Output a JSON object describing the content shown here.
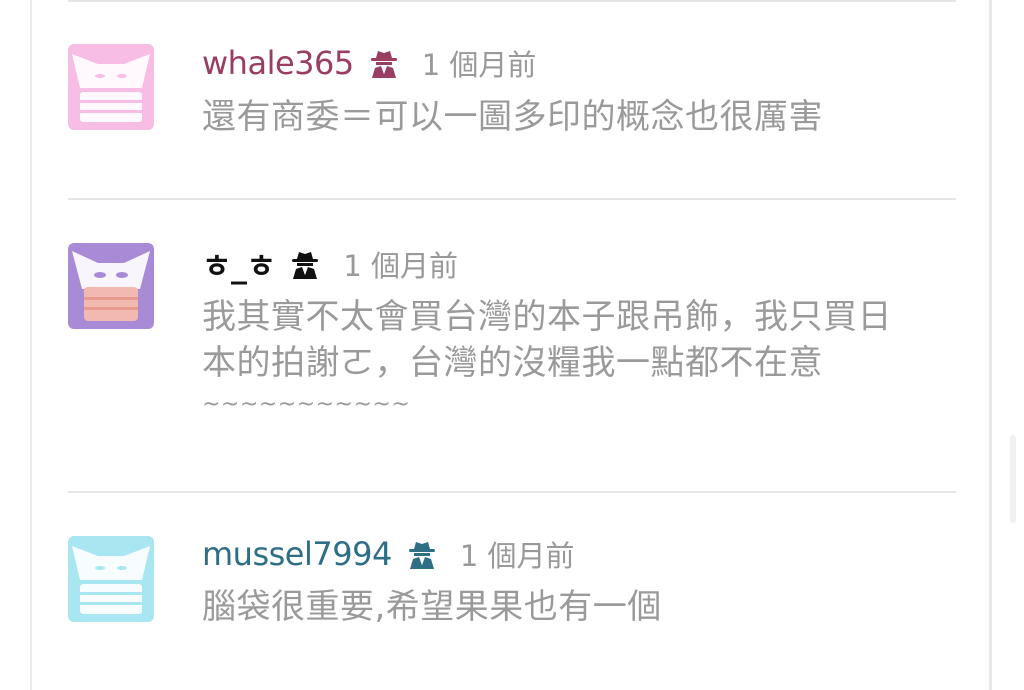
{
  "comments": [
    {
      "username": "whale365",
      "username_color": "#9a3d63",
      "avatar_color": "#f7bde4",
      "anon_icon": "spy-icon",
      "time": "1 個月前",
      "lines": [
        "還有商委＝可以一圖多印的概念也很厲害"
      ]
    },
    {
      "username": "ㅎ_ㅎ",
      "username_color": "#111111",
      "avatar_color": "#a98ad6",
      "anon_icon": "spy-icon",
      "time": "1 個月前",
      "lines": [
        "我其實不太會買台灣的本子跟吊飾，我只買日",
        "本的拍謝ㄛ，台灣的沒糧我一點都不在意",
        "~~~~~~~~~~~"
      ]
    },
    {
      "username": "mussel7994",
      "username_color": "#2f6f86",
      "avatar_color": "#a8e6f1",
      "anon_icon": "spy-icon",
      "time": "1 個月前",
      "lines": [
        "腦袋很重要,希望果果也有一個"
      ]
    }
  ]
}
